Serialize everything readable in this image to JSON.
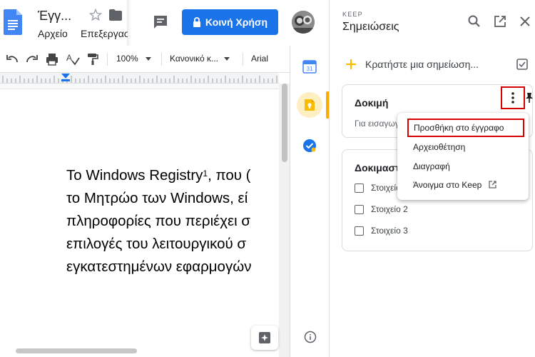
{
  "docs": {
    "title": "Έγγ...",
    "menu": [
      "Αρχείο",
      "Επεξεργασία"
    ],
    "share_label": "Κοινή Χρήση",
    "colors": {
      "share_blue": "#1a73e8",
      "docs_blue": "#4285f4"
    }
  },
  "toolbar": {
    "zoom": "100%",
    "style": "Κανονικό κ...",
    "font": "Arial"
  },
  "document": {
    "lines": [
      "Το Windows Registry",
      "το Μητρώο των Windows, εί",
      "πληροφορίες που περιέχει σ",
      "επιλογές του λειτουργικού σ",
      "εγκατεστημένων εφαρμογών"
    ],
    "footnote_marker": "1",
    "line1_suffix": ", που ("
  },
  "side_rail": {
    "calendar_day": "31",
    "active_accent": "#f9ab00"
  },
  "keep": {
    "kicker": "KEEP",
    "title": "Σημειώσεις",
    "take_note": "Κρατήστε μια σημείωση...",
    "notes": [
      {
        "title": "Δοκιμή",
        "body": "Για εισαγωγή"
      },
      {
        "title": "Δοκιμαστ",
        "items": [
          "Στοιχείο 1",
          "Στοιχείο 2",
          "Στοιχείο 3"
        ]
      }
    ],
    "menu": {
      "items": [
        "Προσθήκη στο έγγραφο",
        "Αρχειοθέτηση",
        "Διαγραφή",
        "Άνοιγμα στο Keep"
      ]
    },
    "colors": {
      "highlight_red": "#d50000",
      "plus_yellow": "#fbbc04"
    }
  }
}
